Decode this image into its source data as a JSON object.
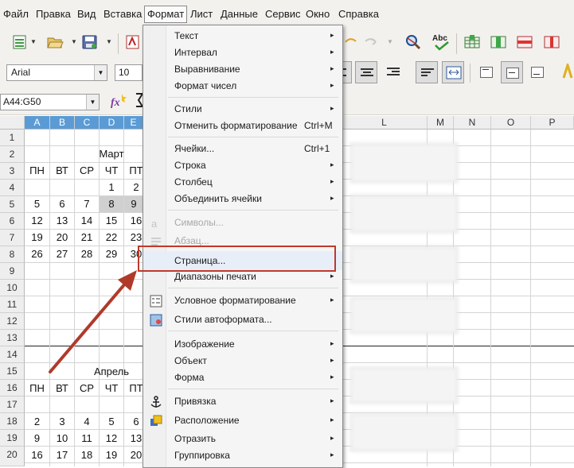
{
  "menubar": {
    "items": [
      "Файл",
      "Правка",
      "Вид",
      "Вставка",
      "Формат",
      "Лист",
      "Данные",
      "Сервис",
      "Окно",
      "Справка"
    ],
    "active_index": 4
  },
  "toolbar": {
    "font_name": "Arial",
    "font_size": "10"
  },
  "formula": {
    "name_box": "A44:G50"
  },
  "columns": [
    "A",
    "B",
    "C",
    "D",
    "E",
    "L",
    "M",
    "N",
    "O",
    "P"
  ],
  "rows": [
    "1",
    "2",
    "3",
    "4",
    "5",
    "6",
    "7",
    "8",
    "9",
    "10",
    "11",
    "12",
    "13",
    "14",
    "15",
    "16",
    "17",
    "18",
    "19",
    "20"
  ],
  "calendar": {
    "march_title": "Март",
    "april_title": "Апрель",
    "weekdays": [
      "ПН",
      "ВТ",
      "СР",
      "ЧТ",
      "ПТ"
    ],
    "march_rows": [
      [
        "",
        "",
        "",
        "1",
        "2"
      ],
      [
        "5",
        "6",
        "7",
        "8",
        "9"
      ],
      [
        "12",
        "13",
        "14",
        "15",
        "16"
      ],
      [
        "19",
        "20",
        "21",
        "22",
        "23"
      ],
      [
        "26",
        "27",
        "28",
        "29",
        "30"
      ]
    ],
    "april_rows": [
      [
        "2",
        "3",
        "4",
        "5",
        "6"
      ],
      [
        "9",
        "10",
        "11",
        "12",
        "13"
      ],
      [
        "16",
        "17",
        "18",
        "19",
        "20"
      ]
    ]
  },
  "menu": {
    "items": [
      {
        "label": "Текст",
        "submenu": true
      },
      {
        "label": "Интервал",
        "submenu": true
      },
      {
        "label": "Выравнивание",
        "submenu": true
      },
      {
        "label": "Формат чисел",
        "submenu": true
      },
      {
        "label": "Стили",
        "submenu": true
      },
      {
        "label": "Отменить форматирование",
        "shortcut": "Ctrl+M"
      },
      {
        "label": "Ячейки...",
        "shortcut": "Ctrl+1"
      },
      {
        "label": "Строка",
        "submenu": true
      },
      {
        "label": "Столбец",
        "submenu": true
      },
      {
        "label": "Объединить ячейки",
        "submenu": true
      },
      {
        "label": "Символы...",
        "disabled": true
      },
      {
        "label": "Абзац...",
        "disabled": true
      },
      {
        "label": "Страница..."
      },
      {
        "label": "Диапазоны печати",
        "submenu": true
      },
      {
        "label": "Условное форматирование",
        "submenu": true
      },
      {
        "label": "Стили автоформата..."
      },
      {
        "label": "Изображение",
        "submenu": true
      },
      {
        "label": "Объект",
        "submenu": true
      },
      {
        "label": "Форма",
        "submenu": true
      },
      {
        "label": "Привязка",
        "submenu": true
      },
      {
        "label": "Расположение",
        "submenu": true
      },
      {
        "label": "Отразить",
        "submenu": true
      },
      {
        "label": "Группировка",
        "submenu": true
      }
    ],
    "submenu_arrow": "▸"
  },
  "colors": {
    "highlight_box": "#c0392b",
    "selected_header": "#5b9bd5",
    "arrow": "#b03a2a"
  }
}
